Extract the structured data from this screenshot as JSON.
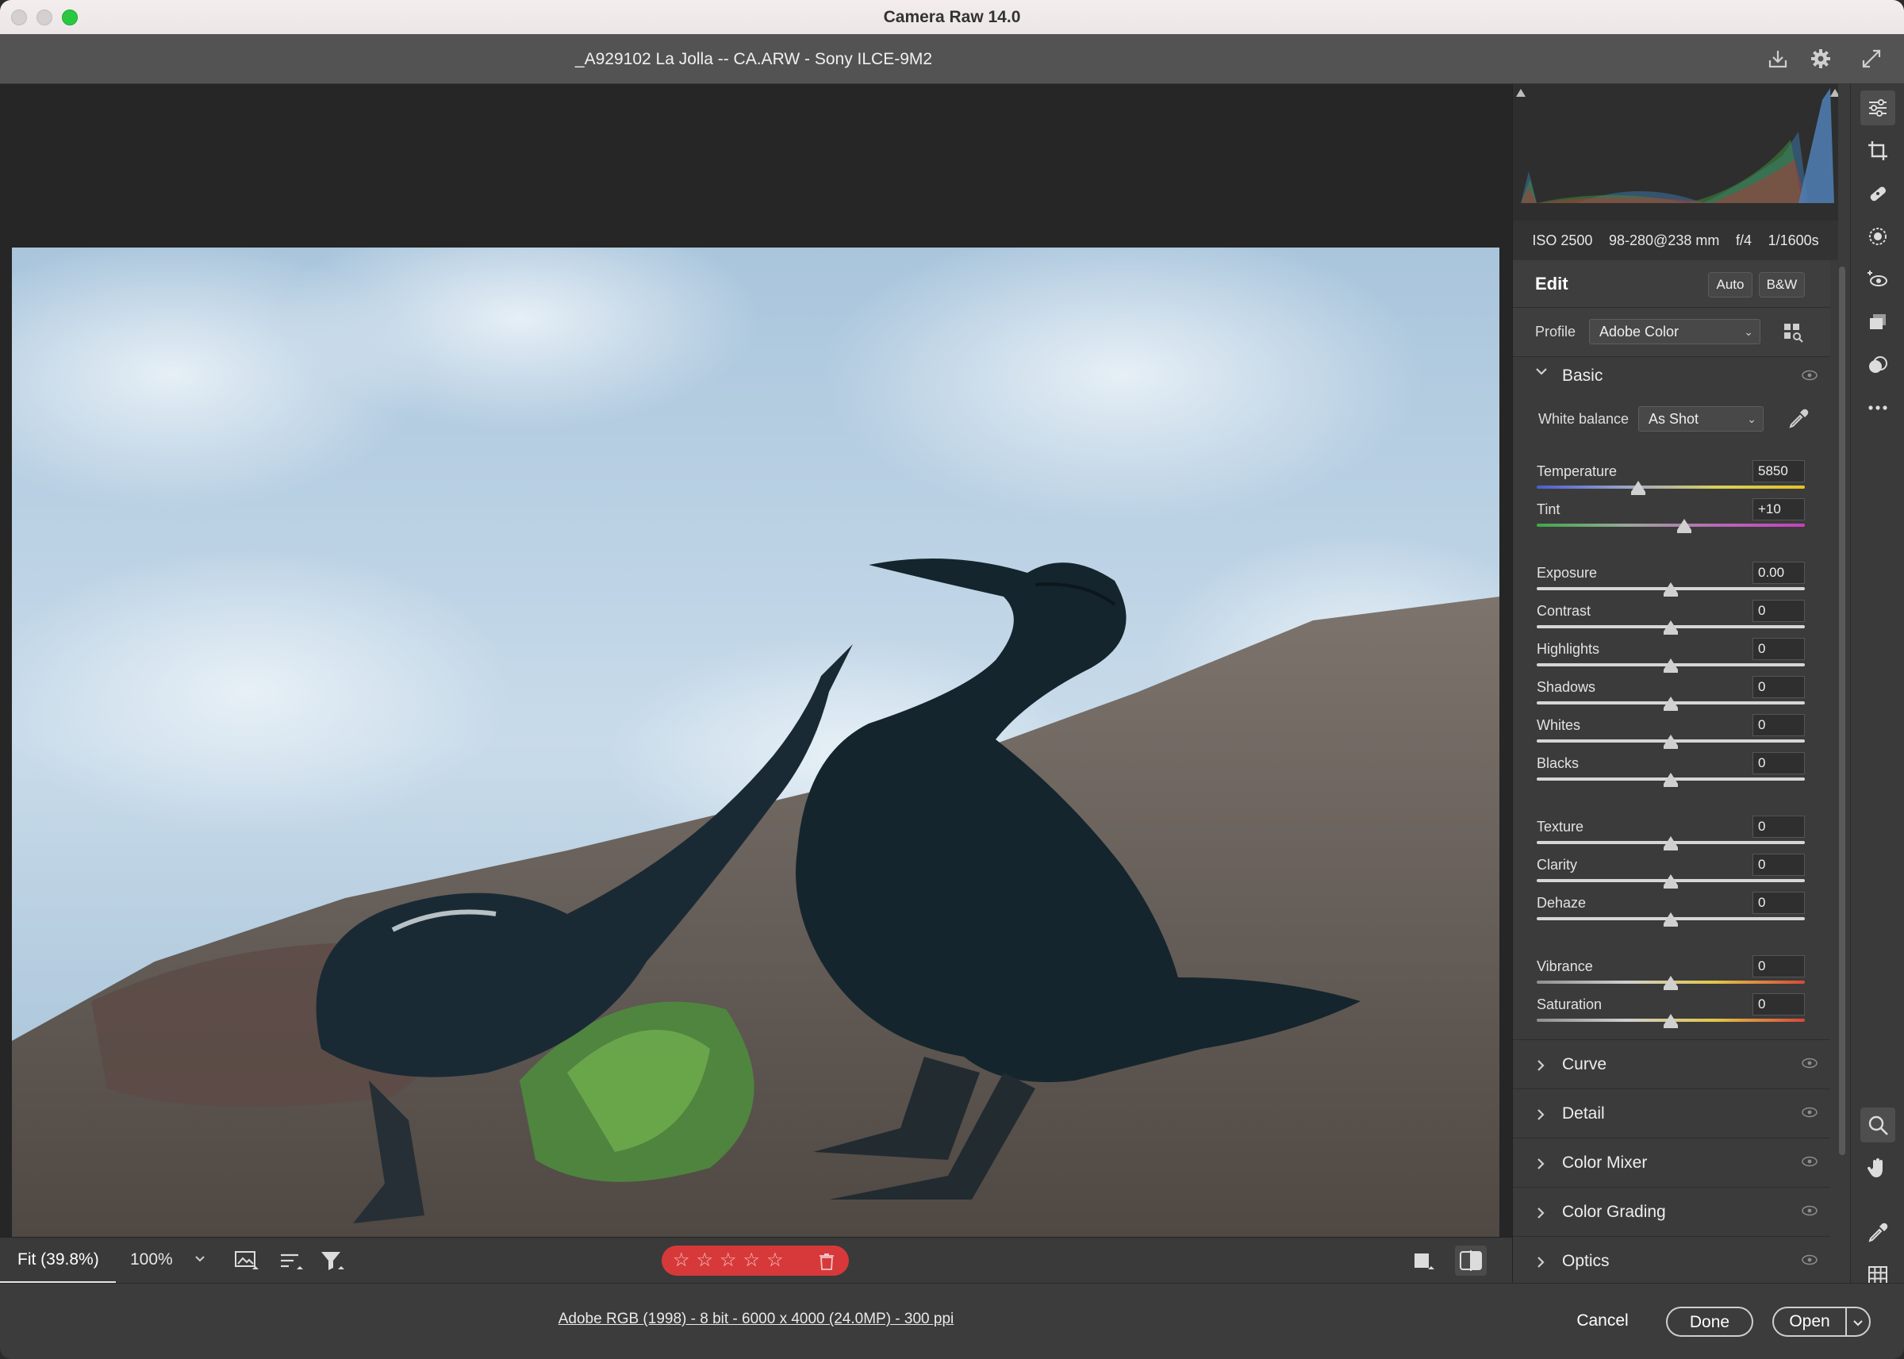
{
  "window": {
    "title": "Camera Raw 14.0"
  },
  "header": {
    "filename": "_A929102  La Jolla -- CA.ARW  -  Sony ILCE-9M2"
  },
  "exif": {
    "iso": "ISO 2500",
    "lens": "98-280@238 mm",
    "aperture": "f/4",
    "shutter": "1/1600s"
  },
  "edit": {
    "title": "Edit",
    "auto_label": "Auto",
    "bw_label": "B&W"
  },
  "profile": {
    "label": "Profile",
    "value": "Adobe Color"
  },
  "basic": {
    "title": "Basic",
    "wb_label": "White balance",
    "wb_value": "As Shot",
    "sliders": [
      {
        "label": "Temperature",
        "value": "5850",
        "pos": 0.38
      },
      {
        "label": "Tint",
        "value": "+10",
        "pos": 0.55
      },
      {
        "label": "Exposure",
        "value": "0.00",
        "pos": 0.5
      },
      {
        "label": "Contrast",
        "value": "0",
        "pos": 0.5
      },
      {
        "label": "Highlights",
        "value": "0",
        "pos": 0.5
      },
      {
        "label": "Shadows",
        "value": "0",
        "pos": 0.5
      },
      {
        "label": "Whites",
        "value": "0",
        "pos": 0.5
      },
      {
        "label": "Blacks",
        "value": "0",
        "pos": 0.5
      },
      {
        "label": "Texture",
        "value": "0",
        "pos": 0.5
      },
      {
        "label": "Clarity",
        "value": "0",
        "pos": 0.5
      },
      {
        "label": "Dehaze",
        "value": "0",
        "pos": 0.5
      },
      {
        "label": "Vibrance",
        "value": "0",
        "pos": 0.5
      },
      {
        "label": "Saturation",
        "value": "0",
        "pos": 0.5
      }
    ]
  },
  "sections": [
    "Curve",
    "Detail",
    "Color Mixer",
    "Color Grading",
    "Optics"
  ],
  "bottombar": {
    "fit_label": "Fit (39.8%)",
    "zoom_label": "100%"
  },
  "footer": {
    "info": "Adobe RGB (1998) - 8 bit - 6000 x 4000 (24.0MP) - 300 ppi",
    "cancel": "Cancel",
    "done": "Done",
    "open": "Open"
  },
  "colors": {
    "accent_red": "#d7393a",
    "panel": "#3b3b3b"
  }
}
